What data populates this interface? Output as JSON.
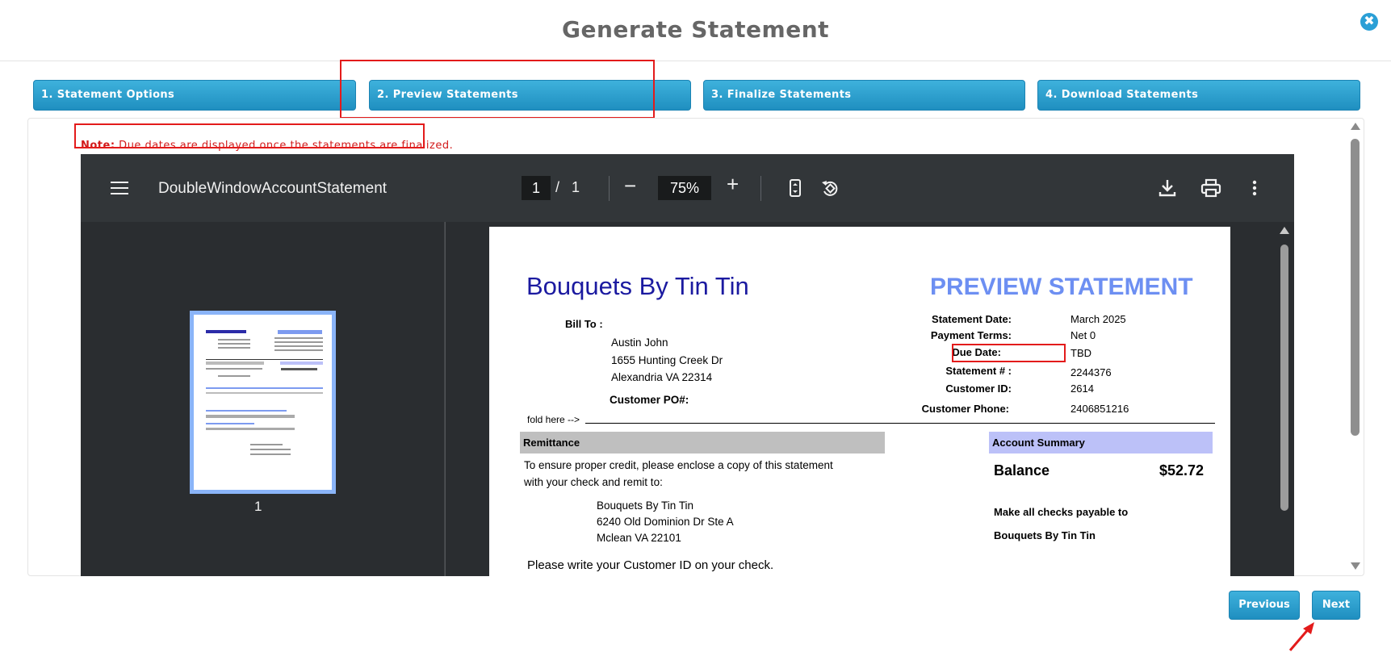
{
  "modal": {
    "title": "Generate Statement",
    "close_glyph": "✖"
  },
  "steps": [
    {
      "label": "1. Statement Options"
    },
    {
      "label": "2. Preview Statements"
    },
    {
      "label": "3. Finalize Statements"
    },
    {
      "label": "4. Download Statements"
    }
  ],
  "note": {
    "prefix": "Note:",
    "text": " Due dates are displayed once the statements are finalized."
  },
  "viewer": {
    "doc_name": "DoubleWindowAccountStatement",
    "page_current": "1",
    "page_sep": "/",
    "page_total": "1",
    "zoom_out": "−",
    "zoom": "75%",
    "zoom_in": "+",
    "thumb_label": "1"
  },
  "statement": {
    "company": "Bouquets By Tin Tin",
    "title": "PREVIEW STATEMENT",
    "bill_to_label": "Bill To :",
    "bill_to": [
      "Austin John",
      "1655 Hunting Creek Dr",
      "Alexandria VA 22314"
    ],
    "customer_po_label": "Customer PO#:",
    "fields": [
      {
        "label": "Statement Date:",
        "value": "March 2025"
      },
      {
        "label": "Payment Terms:",
        "value": "Net 0"
      },
      {
        "label": "Due Date:",
        "value": "TBD"
      },
      {
        "label": "Statement # :",
        "value": "2244376"
      },
      {
        "label": "Customer ID:",
        "value": "2614"
      },
      {
        "label": "Customer Phone:",
        "value": "2406851216"
      }
    ],
    "fold_here": "fold here -->",
    "remittance_header": "Remittance",
    "remittance_text": [
      "To ensure proper credit, please enclose a copy of this statement",
      "with your check and remit to:"
    ],
    "remit_address": [
      "Bouquets By Tin Tin",
      "6240 Old Dominion Dr Ste A",
      "Mclean VA 22101"
    ],
    "write_id": "Please write your Customer ID on your check.",
    "account_summary_header": "Account Summary",
    "balance_label": "Balance",
    "balance_value": "$52.72",
    "checks_payable_label": "Make all checks payable to",
    "checks_payable_to": "Bouquets By Tin Tin"
  },
  "footer": {
    "previous_label": "Previous",
    "next_label": "Next"
  },
  "colors": {
    "accent": "#2a9fd6",
    "annotation_red": "#e31b1b",
    "company_blue": "#1b1aa0",
    "preview_blue": "#6d8ff2"
  }
}
